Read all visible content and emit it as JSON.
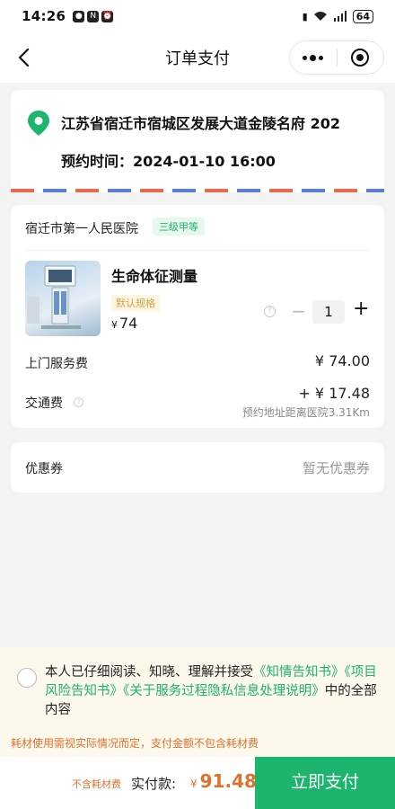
{
  "status_bar": {
    "time": "14:26",
    "battery": "64"
  },
  "nav": {
    "title": "订单支付"
  },
  "address": {
    "text": "江苏省宿迁市宿城区发展大道金陵名府 202",
    "appointment_label": "预约时间：",
    "appointment_time": "2024-01-10 16:00"
  },
  "order": {
    "hospital": "宿迁市第一人民医院",
    "hospital_grade": "三级甲等",
    "product_name": "生命体征测量",
    "spec_tag": "默认规格",
    "currency": "¥",
    "price": "74",
    "minus": "−",
    "quantity": "1",
    "plus": "+",
    "service_fee_label": "上门服务费",
    "service_fee_value": "¥ 74.00",
    "traffic_fee_label": "交通费",
    "traffic_fee_value": "+ ¥ 17.48",
    "distance_note": "预约地址距离医院3.31Km"
  },
  "coupon": {
    "label": "优惠券",
    "value": "暂无优惠券"
  },
  "agreement": {
    "prefix": "本人已仔细阅读、知晓、理解并接受",
    "link1": "《知情告知书》",
    "link2": "《项目风险告知书》",
    "link3": "《关于服务过程隐私信息处理说明》",
    "suffix": "中的全部内容",
    "tip": "耗材使用需视实际情况而定，支付金额不包含耗材费"
  },
  "footer": {
    "no_supply": "不含耗材费",
    "paid_label": "实付款:",
    "currency": "¥",
    "paid_amount": "91.48",
    "pay_button": "立即支付"
  },
  "colors": {
    "accent": "#1db46e",
    "warning": "#e36f2c"
  }
}
